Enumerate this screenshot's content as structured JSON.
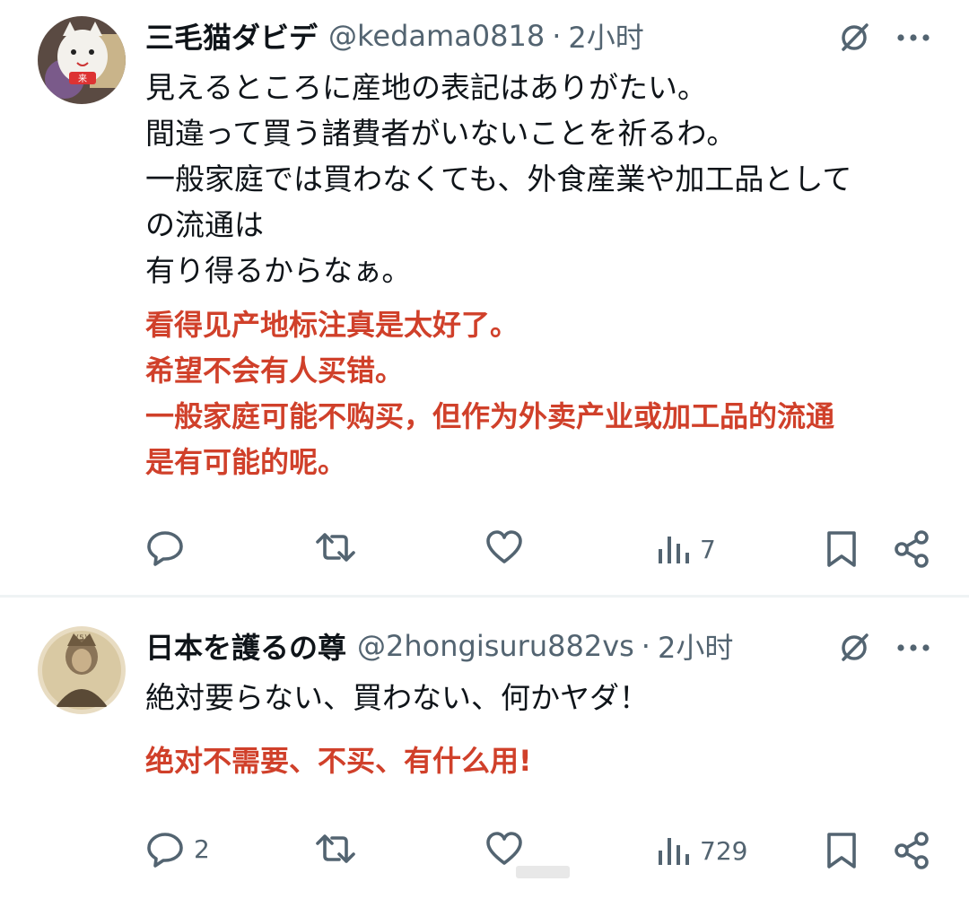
{
  "tweets": [
    {
      "author_name": "三毛猫ダビデ",
      "handle": "@kedama0818",
      "separator": "·",
      "time": "2小时",
      "icons": {
        "grok": "grok-slash-icon",
        "more": "more-dots-icon"
      },
      "lines": [
        "見えるところに産地の表記はありがたい。",
        "間違って買う諸費者がいないことを祈るわ。",
        "一般家庭では買わなくても、外食産業や加工品としての流通は",
        "有り得るからなぁ。"
      ],
      "lines_display": [
        "見えるところに産地の表記はありがたい。",
        "間違って買う諸費者がいないことを祈るわ。",
        "一般家庭では買わなくても、外食産業や加工品として",
        "の流通は",
        "有り得るからなぁ。"
      ],
      "translation": [
        "看得见产地标注真是太好了。",
        "希望不会有人买错。",
        "一般家庭可能不购买，但作为外卖产业或加工品的流通",
        "是有可能的呢。"
      ],
      "actions": {
        "reply_count": "",
        "repost_count": "",
        "like_count": "",
        "views_count": "7"
      }
    },
    {
      "author_name": "日本を護るの尊",
      "handle": "@2hongisuru882vs",
      "separator": "·",
      "time": "2小时",
      "icons": {
        "grok": "grok-slash-icon",
        "more": "more-dots-icon"
      },
      "lines": [
        "絶対要らない、買わない、何かヤダ！"
      ],
      "translation": [
        "绝对不需要、不买、有什么用!"
      ],
      "actions": {
        "reply_count": "2",
        "repost_count": "",
        "like_count": "",
        "views_count": "729"
      }
    }
  ],
  "colors": {
    "text": "#0f1419",
    "muted": "#536471",
    "translation": "#d0402a",
    "divider": "#eff3f4"
  }
}
